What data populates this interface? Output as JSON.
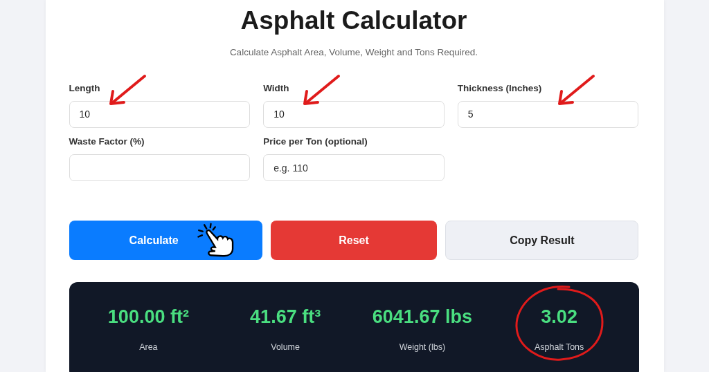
{
  "header": {
    "title": "Asphalt Calculator",
    "subtitle": "Calculate Asphalt Area, Volume, Weight and Tons Required."
  },
  "fields": [
    {
      "label": "Length",
      "value": "10",
      "marked": true
    },
    {
      "label": "Width",
      "value": "10",
      "marked": true
    },
    {
      "label": "Thickness (Inches)",
      "value": "5",
      "marked": true
    },
    {
      "label": "Waste Factor (%)"
    },
    {
      "label": "Price per Ton (optional)",
      "placeholder": "e.g. 110"
    }
  ],
  "buttons": [
    {
      "label": "Calculate",
      "kind": "primary",
      "marked": true
    },
    {
      "label": "Reset",
      "kind": "danger"
    },
    {
      "label": "Copy Result",
      "kind": "light"
    }
  ],
  "results": [
    {
      "value": "100.00 ft²",
      "label": "Area"
    },
    {
      "value": "41.67 ft³",
      "label": "Volume"
    },
    {
      "value": "6041.67 lbs",
      "label": "Weight (lbs)"
    },
    {
      "value": "3.02",
      "label": "Asphalt Tons",
      "marked": true
    }
  ]
}
